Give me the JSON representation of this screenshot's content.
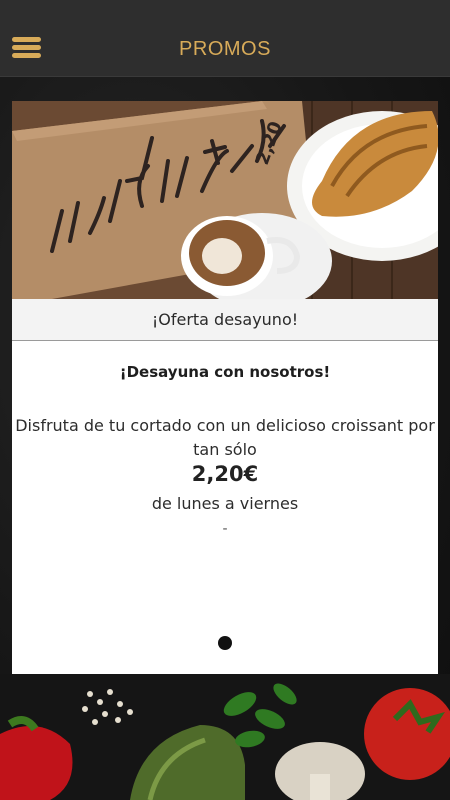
{
  "header": {
    "title": "PROMOS",
    "menu_icon": "hamburger-menu-icon",
    "accent_color": "#d8ab59"
  },
  "promo": {
    "image_sign_text": "CAFÉ O CON + CROISSANT 2,20",
    "caption": "¡Oferta desayuno!",
    "headline": "¡Desayuna con nosotros!",
    "description": "Disfruta de tu cortado con un delicioso croissant por tan sólo",
    "price": "2,20€",
    "availability": "de lunes a viernes",
    "separator": "-"
  },
  "pager": {
    "current_page": 1,
    "total_pages": 1
  }
}
